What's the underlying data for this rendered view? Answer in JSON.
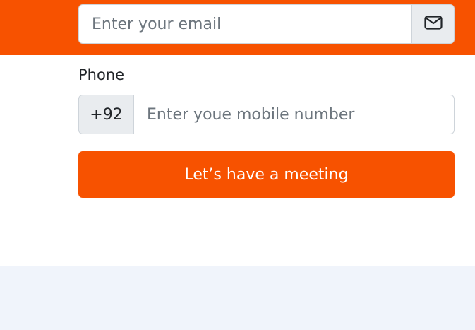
{
  "email": {
    "placeholder": "Enter your email",
    "icon": "envelope-icon"
  },
  "phone": {
    "label": "Phone",
    "prefix": "+92",
    "placeholder": "Enter youe mobile number"
  },
  "cta": {
    "label": "Let’s have a meeting"
  },
  "colors": {
    "brand_orange": "#f75200",
    "addon_gray": "#e9ecef",
    "border_gray": "#ced4da",
    "bottom_band": "#f0f4fb"
  }
}
